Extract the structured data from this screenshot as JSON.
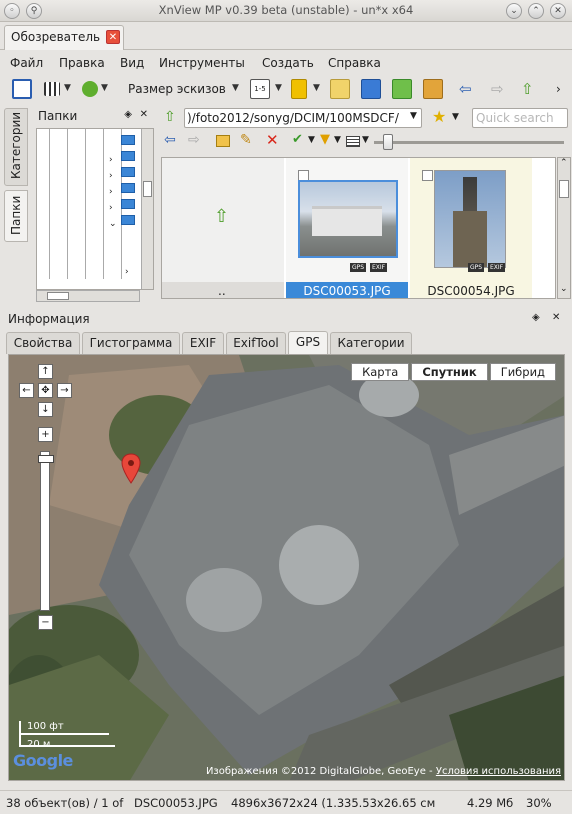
{
  "window": {
    "title": "XnView MP v0.39 beta (unstable) - un*x x64"
  },
  "doc_tab": {
    "label": "Обозреватель"
  },
  "menu": [
    "Файл",
    "Правка",
    "Вид",
    "Инструменты",
    "Создать",
    "Справка"
  ],
  "toolbar": {
    "thumb_size_label": "Размер эскизов"
  },
  "side_tabs": {
    "categories": "Категории",
    "folders": "Папки"
  },
  "folders_panel": {
    "title": "Папки"
  },
  "browser": {
    "path": ")/foto2012/sonyg/DCIM/100MSDCF/",
    "search_placeholder": "Quick search",
    "parent_label": "..",
    "thumbnails": [
      {
        "name": "DSC00053.JPG",
        "selected": true,
        "badges": [
          "GPS",
          "EXIF"
        ]
      },
      {
        "name": "DSC00054.JPG",
        "selected": false,
        "badges": [
          "GPS",
          "EXIF"
        ]
      }
    ]
  },
  "info_panel": {
    "title": "Информация",
    "tabs": [
      "Свойства",
      "Гистограмма",
      "EXIF",
      "ExifTool",
      "GPS",
      "Категории"
    ],
    "active_tab": "GPS"
  },
  "map": {
    "type_buttons": [
      "Карта",
      "Спутник",
      "Гибрид"
    ],
    "selected_type": "Спутник",
    "scale_ft": "100 фт",
    "scale_m": "20 м",
    "logo": "Google",
    "attribution": "Изображения ©2012 DigitalGlobe, GeoEye -",
    "terms_link": "Условия использования"
  },
  "status": {
    "count": "38 объект(ов) / 1 of",
    "filename": "DSC00053.JPG",
    "dimensions": "4896x3672x24 (1.3",
    "print_size": "35.53x26.65 см",
    "filesize": "4.29 Мб",
    "zoom": "30%"
  }
}
